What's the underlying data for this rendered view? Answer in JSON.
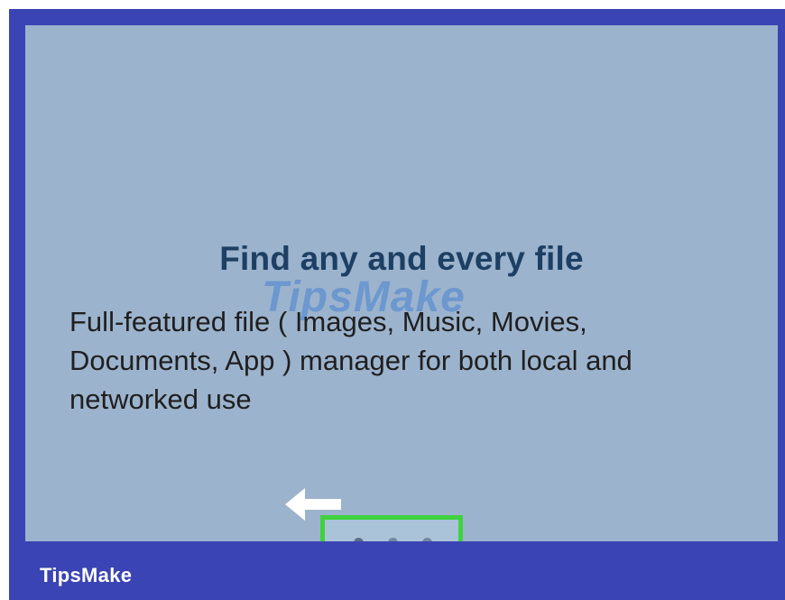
{
  "onboarding": {
    "headline": "Find any and every file",
    "description": "Full-featured file ( Images, Music, Movies, Documents, App ) manager for both local and networked use",
    "back_icon": "arrow-left-icon",
    "page_indicator": {
      "pages": 3,
      "current": 1
    }
  },
  "watermark": {
    "text": "TipsMake"
  },
  "branding": {
    "label": "TipsMake"
  },
  "colors": {
    "border": "#3a44b4",
    "screen_background": "#9cb3cd",
    "headline": "#1d3f63",
    "highlight": "#3fd23f"
  }
}
